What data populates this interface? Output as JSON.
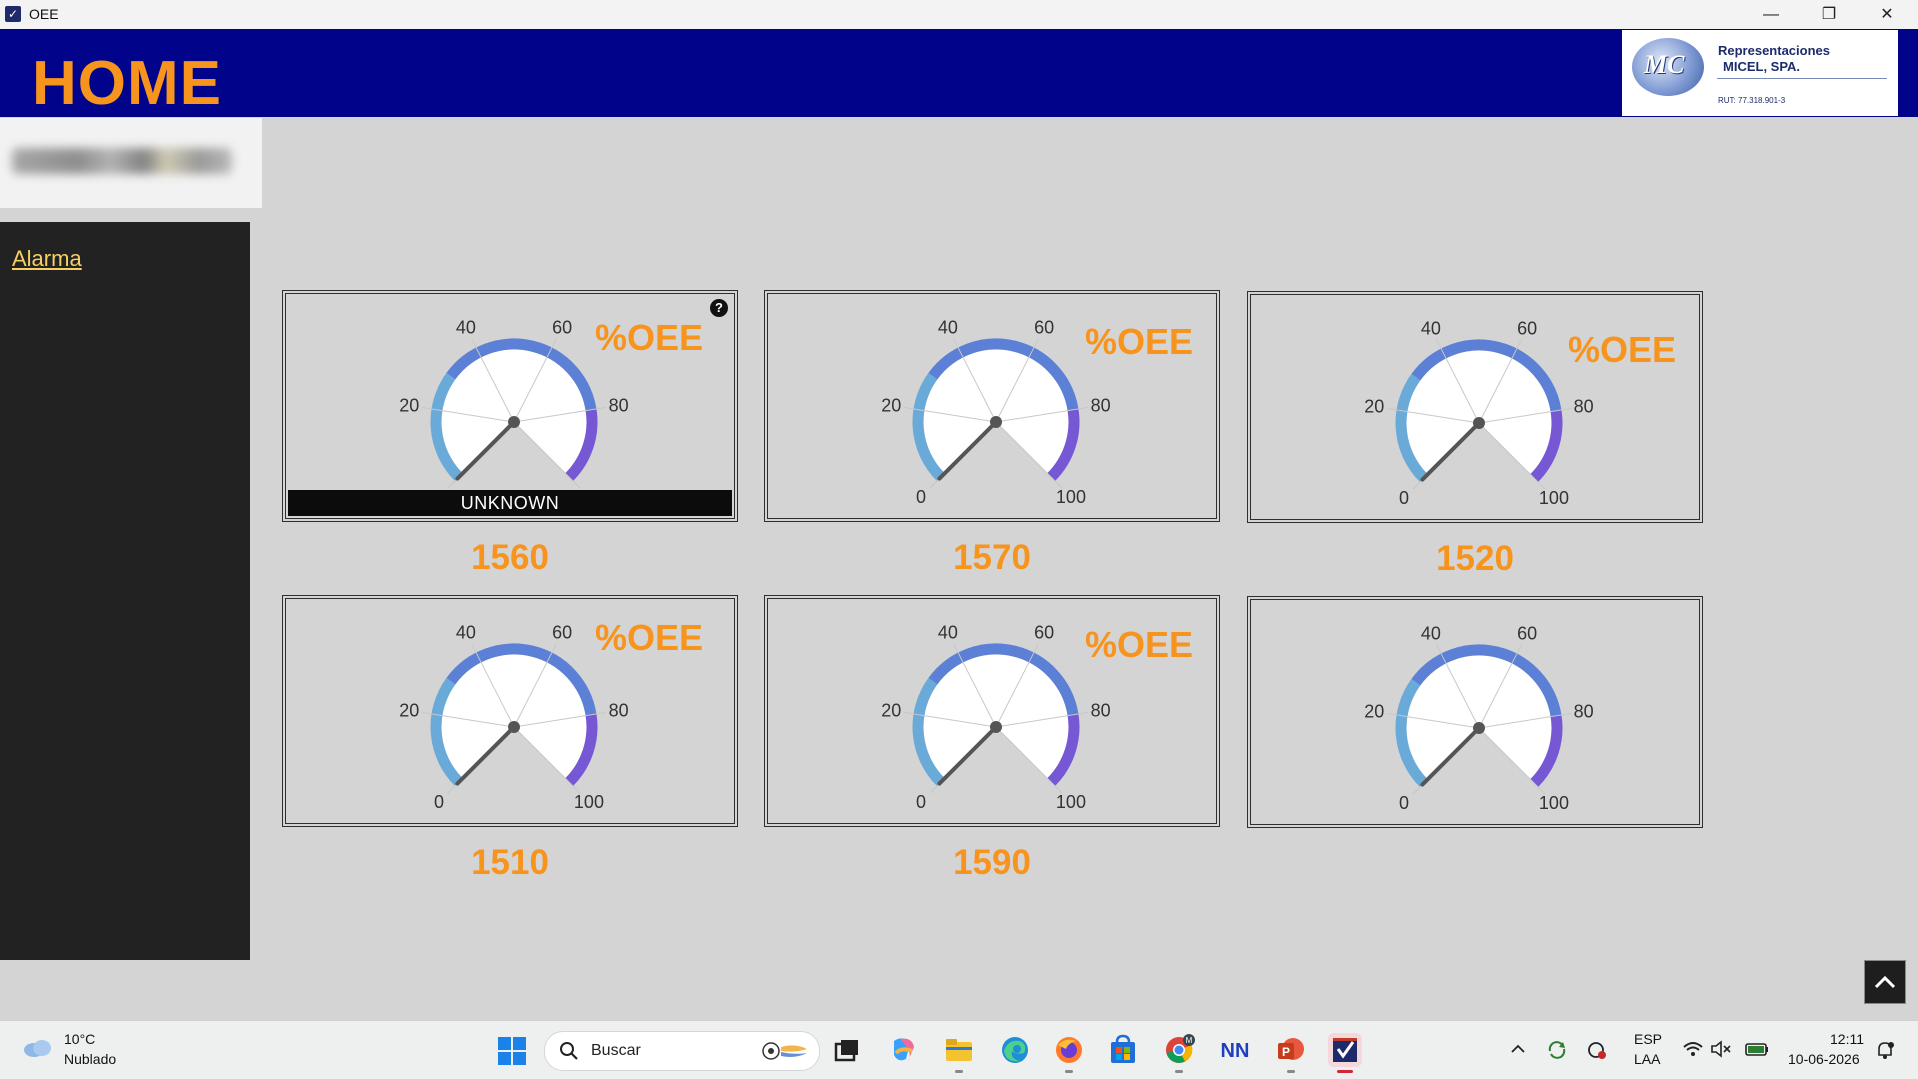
{
  "window": {
    "title": "OEE",
    "minimize": "—",
    "restore": "❐",
    "close": "✕"
  },
  "header": {
    "title": "HOME",
    "logo": {
      "monogram": "MC",
      "line1": "Representaciones",
      "line2": "MICEL, SPA.",
      "rut": "RUT: 77.318.901-3"
    }
  },
  "sidebar": {
    "alarm_link": "Alarma"
  },
  "gauge_panels": [
    {
      "machine": "1560",
      "title": "%OEE",
      "status": "UNKNOWN",
      "help": "?",
      "value": 0
    },
    {
      "machine": "1570",
      "title": "%OEE",
      "status": "",
      "help": "",
      "value": 0
    },
    {
      "machine": "1520",
      "title": "%OEE",
      "status": "",
      "help": "",
      "value": 0
    },
    {
      "machine": "1510",
      "title": "%OEE",
      "status": "",
      "help": "",
      "value": 0
    },
    {
      "machine": "1590",
      "title": "%OEE",
      "status": "",
      "help": "",
      "value": 0
    },
    {
      "machine": "",
      "title": "",
      "status": "",
      "help": "",
      "value": 0
    }
  ],
  "gauge_scale": {
    "min": 0,
    "max": 100,
    "tick_labels": [
      "0",
      "20",
      "40",
      "60",
      "80",
      "100"
    ],
    "bands": [
      {
        "from": 0,
        "to": 30,
        "color": "#6aaad8"
      },
      {
        "from": 30,
        "to": 80,
        "color": "#5b80d6"
      },
      {
        "from": 80,
        "to": 100,
        "color": "#7657d4"
      }
    ]
  },
  "taskbar": {
    "weather_temp": "10°C",
    "weather_desc": "Nublado",
    "search_placeholder": "Buscar",
    "apps": [
      "task-view",
      "copilot",
      "file-explorer",
      "edge",
      "firefox",
      "store",
      "chrome",
      "nn-app",
      "powerpoint",
      "oee-app"
    ],
    "lang1": "ESP",
    "lang2": "LAA",
    "time": "12:11",
    "date": "10-06-2026"
  }
}
